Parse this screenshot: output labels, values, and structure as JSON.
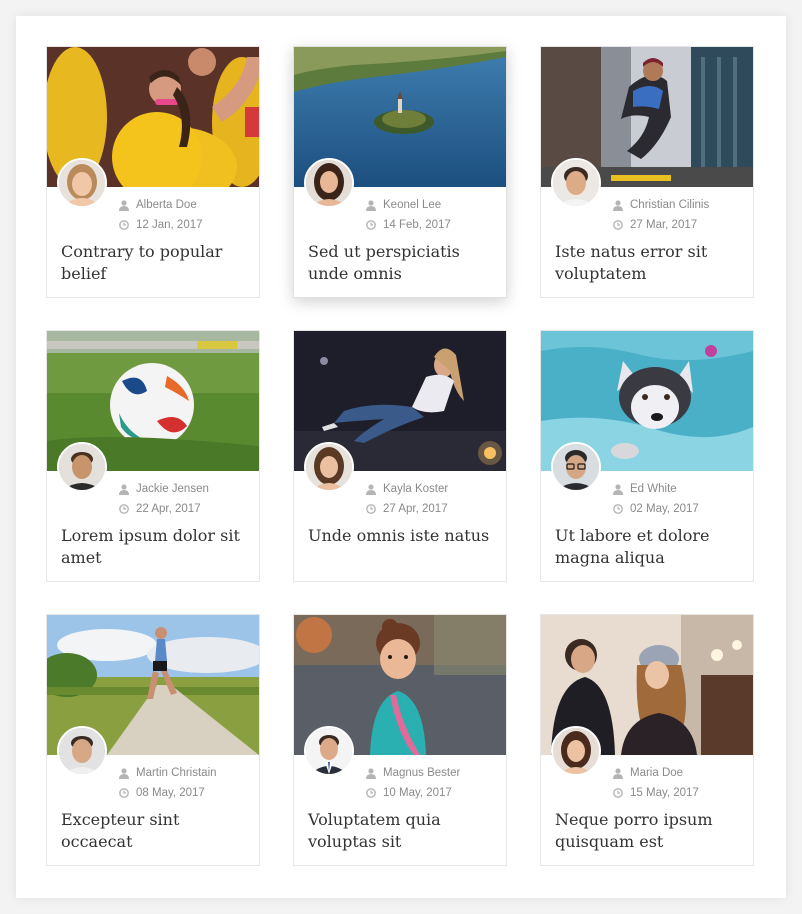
{
  "posts": [
    {
      "author": "Alberta Doe",
      "date": "12 Jan, 2017",
      "title": "Contrary to popular belief",
      "image": "volunteer-in-yellow-shirt-photo",
      "avatar": "woman-avatar"
    },
    {
      "author": "Keonel Lee",
      "date": "14 Feb, 2017",
      "title": "Sed ut perspiciatis unde omnis",
      "image": "lake-island-aerial-photo",
      "avatar": "woman-avatar"
    },
    {
      "author": "Christian Cilinis",
      "date": "27 Mar, 2017",
      "title": "Iste natus error sit voluptatem",
      "image": "street-skater-city-photo",
      "avatar": "man-avatar"
    },
    {
      "author": "Jackie Jensen",
      "date": "22 Apr, 2017",
      "title": "Lorem ipsum dolor sit amet",
      "image": "soccer-ball-on-grass-photo",
      "avatar": "man-avatar"
    },
    {
      "author": "Kayla Koster",
      "date": "27 Apr, 2017",
      "title": "Unde omnis iste natus",
      "image": "woman-with-sparkler-photo",
      "avatar": "woman-avatar"
    },
    {
      "author": "Ed White",
      "date": "02 May, 2017",
      "title": "Ut labore et dolore magna aliqua",
      "image": "husky-swimming-pool-photo",
      "avatar": "man-glasses-avatar"
    },
    {
      "author": "Martin Christain",
      "date": "08 May, 2017",
      "title": "Excepteur sint occaecat",
      "image": "runner-on-country-road-photo",
      "avatar": "man-avatar"
    },
    {
      "author": "Magnus Bester",
      "date": "10 May, 2017",
      "title": "Voluptatem quia voluptas sit",
      "image": "little-girl-portrait-photo",
      "avatar": "man-suit-avatar"
    },
    {
      "author": "Maria Doe",
      "date": "15 May, 2017",
      "title": "Neque porro ipsum quisquam est",
      "image": "cafe-friends-photo",
      "avatar": "woman-avatar"
    }
  ],
  "colors": {
    "background": "#f3f3f3",
    "panel": "#ffffff",
    "title_text": "#333333",
    "meta_text": "#8a8a8a",
    "icon": "#b5b5b5"
  }
}
